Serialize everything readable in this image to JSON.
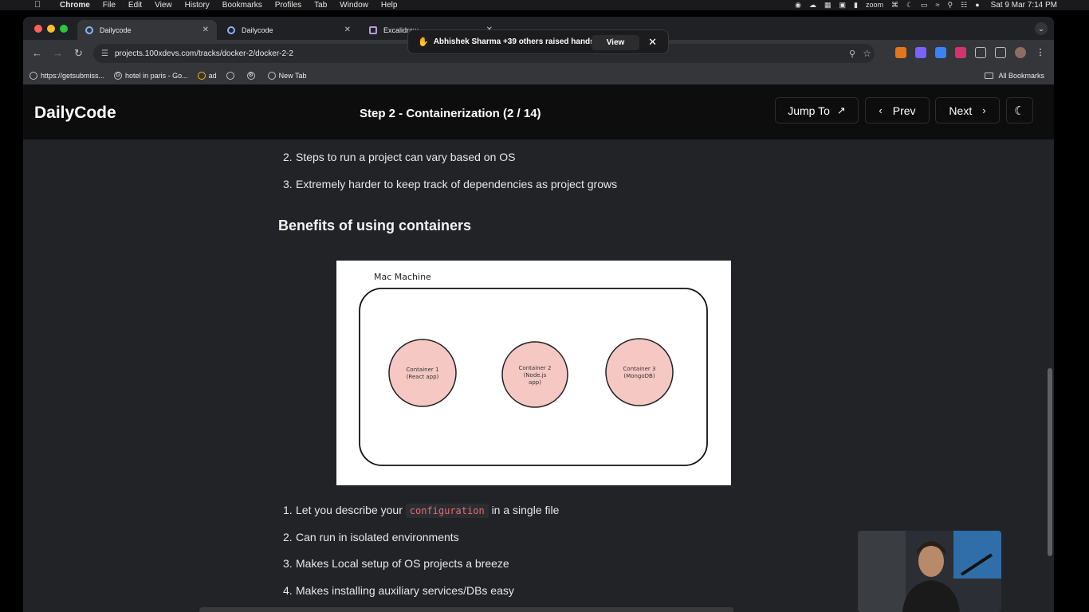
{
  "menubar": {
    "app": "Chrome",
    "items": [
      "File",
      "Edit",
      "View",
      "History",
      "Bookmarks",
      "Profiles",
      "Tab",
      "Window",
      "Help"
    ],
    "zoom_label": "zoom",
    "clock": "Sat 9 Mar  7:14 PM"
  },
  "tabs": [
    {
      "title": "Dailycode"
    },
    {
      "title": "Dailycode"
    },
    {
      "title": "Excalidraw"
    }
  ],
  "toolbar": {
    "url": "projects.100xdevs.com/tracks/docker-2/docker-2-2"
  },
  "bookmarks": {
    "items": [
      "https://getsubmiss...",
      "hotel in paris - Go...",
      "ad",
      "",
      "",
      "New Tab"
    ],
    "all_label": "All Bookmarks"
  },
  "notification": {
    "message": "Abhishek Sharma +39 others raised hands",
    "view_label": "View"
  },
  "header": {
    "logo": "DailyCode",
    "step_title": "Step 2 - Containerization (2 / 14)",
    "jump_label": "Jump To",
    "prev_label": "Prev",
    "next_label": "Next"
  },
  "content": {
    "list_top": [
      {
        "num": "2.",
        "text": "Steps to run a project can vary based on OS"
      },
      {
        "num": "3.",
        "text": "Extremely harder to keep track of dependencies as project grows"
      }
    ],
    "section_title": "Benefits of using containers",
    "diagram": {
      "machine_label": "Mac Machine",
      "containers": [
        {
          "line1": "Container 1",
          "line2": "(React app)",
          "line3": ""
        },
        {
          "line1": "Container 2",
          "line2": "(Node.js",
          "line3": "app)"
        },
        {
          "line1": "Container 3",
          "line2": "(MongoDB)",
          "line3": ""
        }
      ]
    },
    "list_bottom": {
      "item1_num": "1.",
      "item1_pre": "Let you describe your",
      "item1_code": "configuration",
      "item1_post": "in a single file",
      "items": [
        {
          "num": "2.",
          "text": "Can run in isolated environments"
        },
        {
          "num": "3.",
          "text": "Makes Local setup of OS projects a breeze"
        },
        {
          "num": "4.",
          "text": "Makes installing auxiliary services/DBs easy"
        }
      ]
    }
  },
  "colors": {
    "header_bg": "#0d0d0e",
    "page_bg": "#222326",
    "container_fill": "#f6c8c3",
    "code_text": "#e06c75"
  }
}
